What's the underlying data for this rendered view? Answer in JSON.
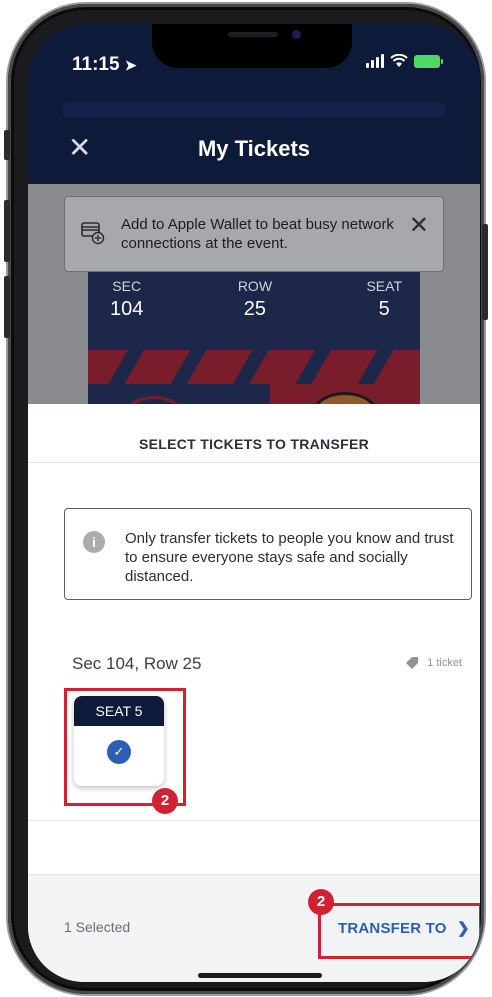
{
  "status_bar": {
    "time": "11:15"
  },
  "header": {
    "title": "My Tickets",
    "close_icon": "close-icon"
  },
  "banner": {
    "text": "Add to Apple Wallet to beat busy network connections at the event.",
    "icon": "wallet-add-icon"
  },
  "ticket_preview": {
    "sec_label": "SEC",
    "sec_value": "104",
    "row_label": "ROW",
    "row_value": "25",
    "seat_label": "SEAT",
    "seat_value": "5"
  },
  "sheet": {
    "title": "SELECT TICKETS TO TRANSFER",
    "notice": "Only transfer tickets to people you know and trust to ensure everyone stays safe and socially distanced.",
    "section_row": "Sec 104, Row 25",
    "ticket_count": "1 ticket",
    "seat_card_label": "SEAT 5",
    "seat_selected": true
  },
  "footer": {
    "selected_text": "1 Selected",
    "transfer_label": "TRANSFER TO"
  },
  "annotations": {
    "badge_seat": "2",
    "badge_transfer": "2"
  },
  "colors": {
    "navy": "#0e1a3a",
    "accent_blue": "#2e5db4",
    "highlight_red": "#d12232"
  }
}
